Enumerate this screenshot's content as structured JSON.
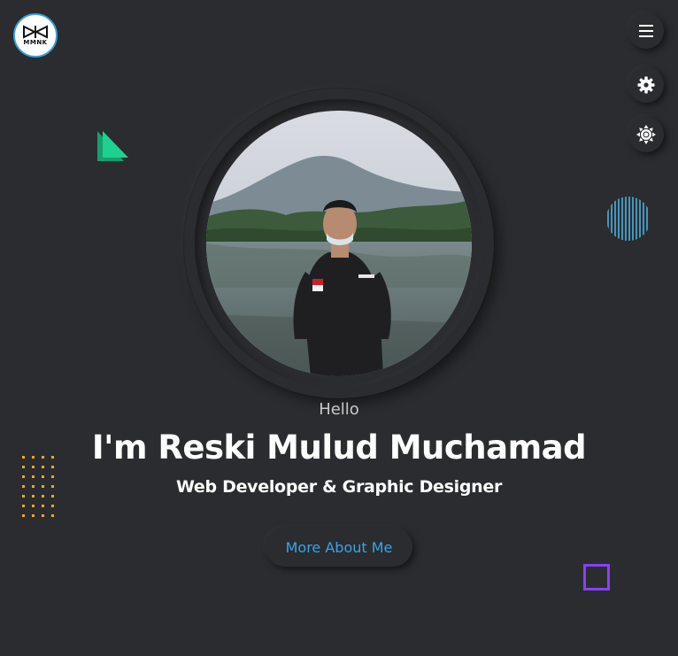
{
  "brand": {
    "logo_text": "MMNK"
  },
  "hero": {
    "greeting": "Hello",
    "name": "I'm Reski Mulud Muchamad",
    "role": "Web Developer & Graphic Designer",
    "cta_label": "More About Me"
  },
  "icons": {
    "menu": "menu-icon",
    "settings": "gear-icon",
    "theme": "sun-icon"
  },
  "colors": {
    "background": "#2b2c2f",
    "accent": "#37a4e8",
    "triangle": "#1fd090",
    "dots": "#f5a623",
    "square": "#8a3ffc",
    "lines": "#4fc3f7"
  }
}
